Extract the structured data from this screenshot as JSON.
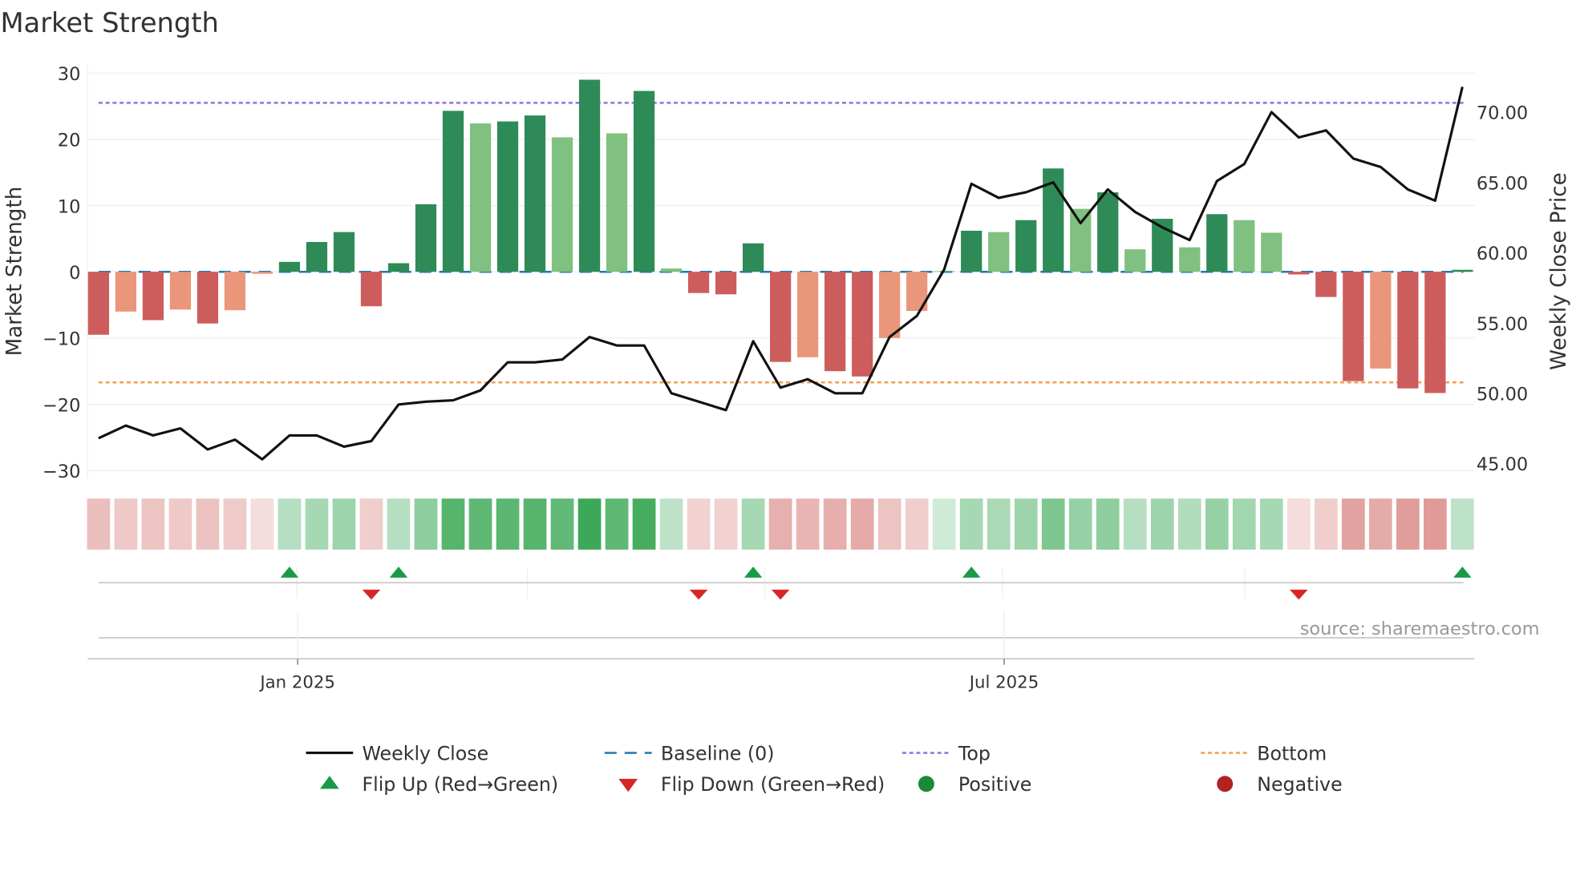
{
  "chart_data": {
    "type": "bar",
    "title": "Market Strength",
    "ylabel": "Market Strength",
    "y2label": "Weekly Close Price",
    "ylim": [
      -30,
      30
    ],
    "y2lim": [
      45,
      72.5
    ],
    "yticks": [
      "30",
      "20",
      "10",
      "0",
      "−10",
      "−20",
      "−30"
    ],
    "ytick_values": [
      30,
      20,
      10,
      0,
      -10,
      -20,
      -30
    ],
    "y2ticks": [
      "70.00",
      "65.00",
      "60.00",
      "55.00",
      "50.00",
      "45.00"
    ],
    "y2tick_values": [
      70,
      65,
      60,
      55,
      50,
      45
    ],
    "xticks": [
      {
        "label": "Jan 2025",
        "week_index": 7.3
      },
      {
        "label": "Jul 2025",
        "week_index": 33.2
      }
    ],
    "strength": [
      -9.5,
      -6,
      -7.3,
      -5.7,
      -7.8,
      -5.8,
      -0.3,
      1.5,
      4.5,
      6,
      -5.2,
      1.3,
      10.2,
      24.3,
      22.4,
      22.7,
      23.6,
      20.3,
      29,
      20.9,
      27.3,
      0.5,
      -3.2,
      -3.4,
      4.3,
      -13.6,
      -12.9,
      -15,
      -15.8,
      -10,
      -5.9,
      0.1,
      6.2,
      6,
      7.8,
      15.6,
      9.5,
      12,
      3.4,
      8,
      3.7,
      8.7,
      7.8,
      5.9,
      -0.4,
      -3.8,
      -16.5,
      -14.6,
      -17.6,
      -18.3,
      0.3
    ],
    "strong": [
      1,
      0,
      1,
      0,
      1,
      0,
      0,
      1,
      1,
      1,
      1,
      1,
      1,
      1,
      0,
      1,
      1,
      0,
      1,
      0,
      1,
      0,
      1,
      1,
      1,
      1,
      0,
      1,
      1,
      0,
      0,
      0,
      1,
      0,
      1,
      1,
      0,
      1,
      0,
      1,
      0,
      1,
      0,
      0,
      1,
      1,
      1,
      0,
      1,
      1,
      1
    ],
    "heat": [
      0.45,
      0.35,
      0.4,
      0.35,
      0.42,
      0.34,
      0.15,
      0.25,
      0.35,
      0.4,
      0.3,
      0.25,
      0.5,
      0.85,
      0.8,
      0.82,
      0.85,
      0.78,
      1,
      0.8,
      0.95,
      0.2,
      0.25,
      0.25,
      0.35,
      0.6,
      0.55,
      0.62,
      0.65,
      0.4,
      0.3,
      0.1,
      0.35,
      0.33,
      0.4,
      0.6,
      0.45,
      0.5,
      0.25,
      0.4,
      0.28,
      0.45,
      0.38,
      0.35,
      0.15,
      0.3,
      0.75,
      0.65,
      0.8,
      0.82,
      0.2
    ],
    "weekly_close": [
      46.8,
      47.7,
      47.0,
      47.5,
      46.0,
      46.7,
      45.3,
      47.0,
      47.0,
      46.2,
      46.6,
      49.2,
      49.4,
      49.5,
      50.2,
      52.2,
      52.2,
      52.4,
      54.0,
      53.4,
      53.4,
      50.0,
      49.4,
      48.8,
      53.7,
      50.4,
      51.0,
      50.0,
      50.0,
      54.0,
      55.5,
      58.8,
      64.9,
      63.9,
      64.3,
      65.0,
      62.1,
      64.5,
      62.9,
      61.8,
      60.9,
      65.1,
      66.3,
      70.0,
      68.2,
      68.7,
      66.7,
      66.1,
      64.5,
      63.7,
      71.8
    ],
    "baseline": 0,
    "top": 25.5,
    "bottom": -16.7,
    "flip_up_weeks": [
      7,
      11,
      24,
      32,
      50
    ],
    "flip_down_weeks": [
      10,
      22,
      25,
      44
    ],
    "colors": {
      "pos_strong": "#2e8b57",
      "pos_weak": "#80c080",
      "neg_strong": "#cd5c5c",
      "neg_weak": "#e9967a",
      "line": "#111111",
      "baseline": "#1f77b4",
      "top": "#9370db",
      "bottom": "#f0a050",
      "flip_up": "#1a9a48",
      "flip_down": "#d62728",
      "positive": "#1a8a3a",
      "negative": "#b22222"
    },
    "legend": [
      {
        "label": "Weekly Close",
        "kind": "line"
      },
      {
        "label": "Baseline (0)",
        "kind": "baseline"
      },
      {
        "label": "Top",
        "kind": "top"
      },
      {
        "label": "Bottom",
        "kind": "bottom"
      },
      {
        "label": "Flip Up (Red→Green)",
        "kind": "flip_up"
      },
      {
        "label": "Flip Down (Green→Red)",
        "kind": "flip_down"
      },
      {
        "label": "Positive",
        "kind": "positive"
      },
      {
        "label": "Negative",
        "kind": "negative"
      }
    ],
    "source": "source: sharemaestro.com"
  }
}
